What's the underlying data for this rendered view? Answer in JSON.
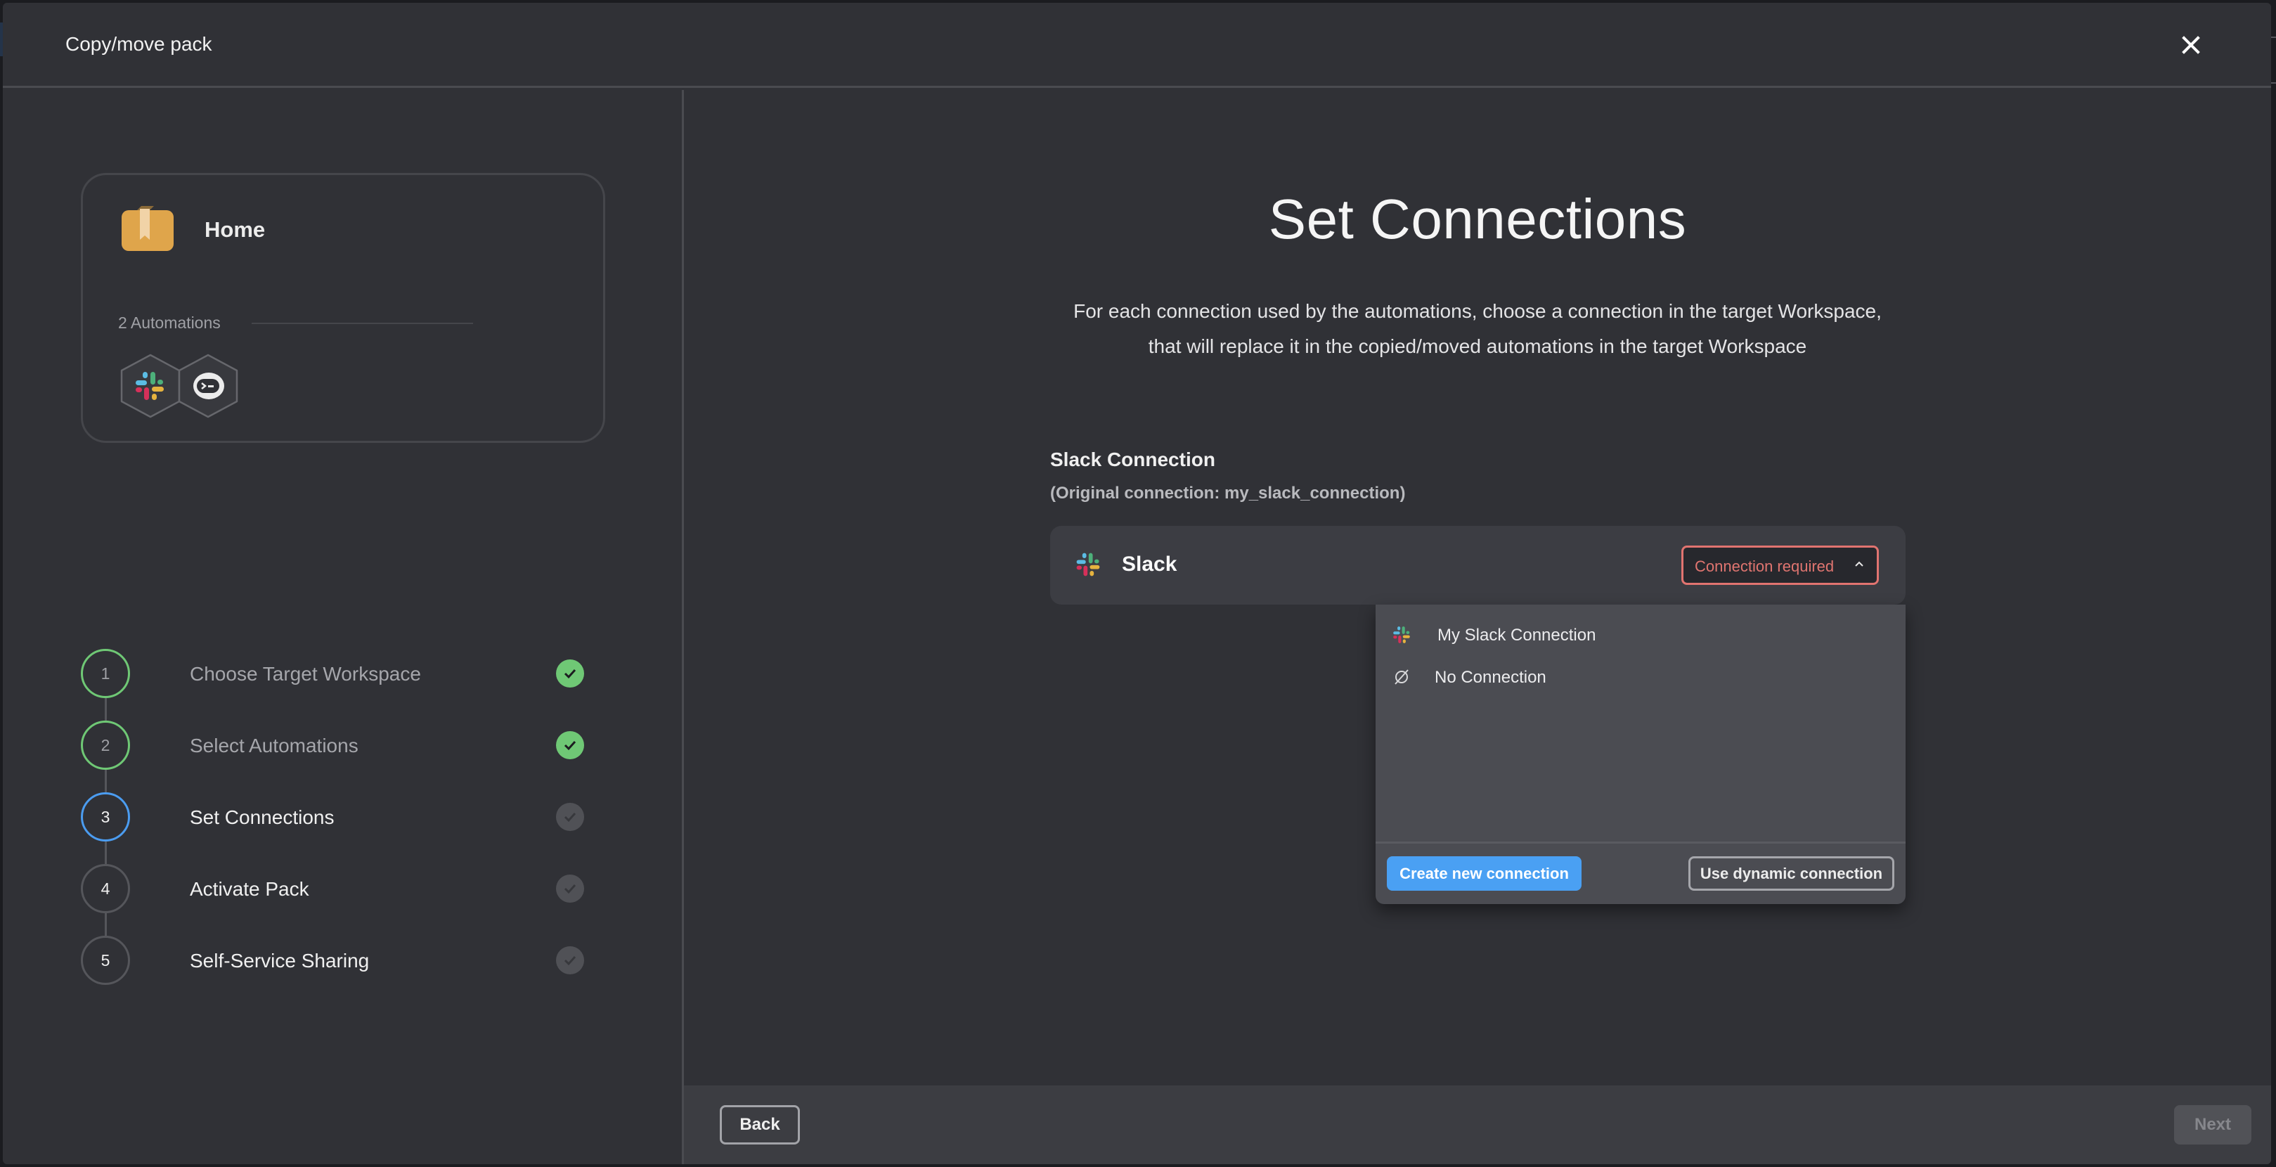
{
  "modal": {
    "title": "Copy/move pack",
    "close_icon": "close-icon"
  },
  "pack": {
    "name": "Home",
    "icon": "pack-book-icon",
    "automation_count_label": "2 Automations",
    "automation_icons": [
      "slack-icon",
      "terminal-bot-icon"
    ]
  },
  "steps": [
    {
      "number": "1",
      "label": "Choose Target Workspace",
      "status": "done"
    },
    {
      "number": "2",
      "label": "Select Automations",
      "status": "done"
    },
    {
      "number": "3",
      "label": "Set Connections",
      "status": "active"
    },
    {
      "number": "4",
      "label": "Activate Pack",
      "status": "pending"
    },
    {
      "number": "5",
      "label": "Self-Service Sharing",
      "status": "pending"
    }
  ],
  "main": {
    "title": "Set Connections",
    "description_line1": "For each connection used by the automations, choose a connection in the target Workspace,",
    "description_line2": "that will replace it in the copied/moved automations in the target Workspace"
  },
  "connection": {
    "title": "Slack Connection",
    "original": "(Original connection: my_slack_connection)",
    "service_name": "Slack",
    "select_value": "Connection required",
    "dropdown_open": true,
    "options": [
      {
        "label": "My Slack Connection",
        "icon": "slack-icon"
      },
      {
        "label": "No Connection",
        "icon": "empty-set-icon"
      }
    ],
    "create_button": "Create new connection",
    "dynamic_button": "Use dynamic connection"
  },
  "footer": {
    "back_label": "Back",
    "next_label": "Next",
    "next_disabled": true
  },
  "colors": {
    "accent_blue": "#4aa0f3",
    "success_green": "#6fc875",
    "error_red": "#e17470",
    "pack_orange": "#dfa54b"
  }
}
